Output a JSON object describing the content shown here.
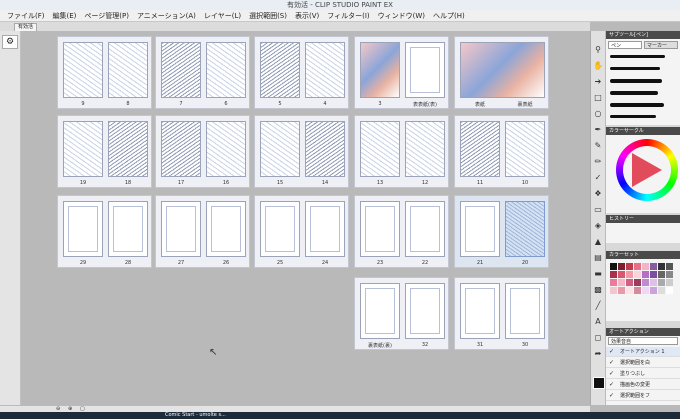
{
  "window": {
    "title": "有効活 - CLIP STUDIO PAINT EX"
  },
  "menu": [
    "ファイル(F)",
    "編集(E)",
    "ページ管理(P)",
    "アニメーション(A)",
    "レイヤー(L)",
    "選択範囲(S)",
    "表示(V)",
    "フィルター(I)",
    "ウィンドウ(W)",
    "ヘルプ(H)"
  ],
  "tab": {
    "label": "有効活"
  },
  "pages": {
    "row1": [
      {
        "left": "9",
        "right": "8"
      },
      {
        "left": "7",
        "right": "6"
      },
      {
        "left": "5",
        "right": "4"
      },
      {
        "left": "3",
        "right": "表表紙(表)"
      },
      {
        "left": "表紙",
        "right": "裏表紙"
      }
    ],
    "row2": [
      {
        "left": "19",
        "right": "18"
      },
      {
        "left": "17",
        "right": "16"
      },
      {
        "left": "15",
        "right": "14"
      },
      {
        "left": "13",
        "right": "12"
      },
      {
        "left": "11",
        "right": "10"
      }
    ],
    "row3": [
      {
        "left": "29",
        "right": "28"
      },
      {
        "left": "27",
        "right": "26"
      },
      {
        "left": "25",
        "right": "24"
      },
      {
        "left": "23",
        "right": "22"
      },
      {
        "left": "21",
        "right": "20"
      }
    ],
    "row4": [
      {
        "left": "裏表紙(裏)",
        "right": "32"
      },
      {
        "left": "31",
        "right": "30"
      }
    ]
  },
  "panels": {
    "subtool": {
      "title": "サブツール[ペン]",
      "tab1": "ペン",
      "tab2": "マーカー"
    },
    "color": {
      "title": "カラーサークル"
    },
    "history": {
      "title": "ヒストリー"
    },
    "colorset": {
      "title": "カラーセット"
    },
    "autoaction": {
      "title": "オートアクション",
      "set": "効果音自",
      "items": [
        "オートアクション 1",
        "選択範囲を白",
        "塗りつぶし",
        "描画色の変更",
        "選択範囲をフ"
      ]
    }
  },
  "taskbar": {
    "item": "Comic Start - umolte s..."
  },
  "colors": {
    "accent": "#e24b5b",
    "panel_header": "#4a4a4a"
  }
}
